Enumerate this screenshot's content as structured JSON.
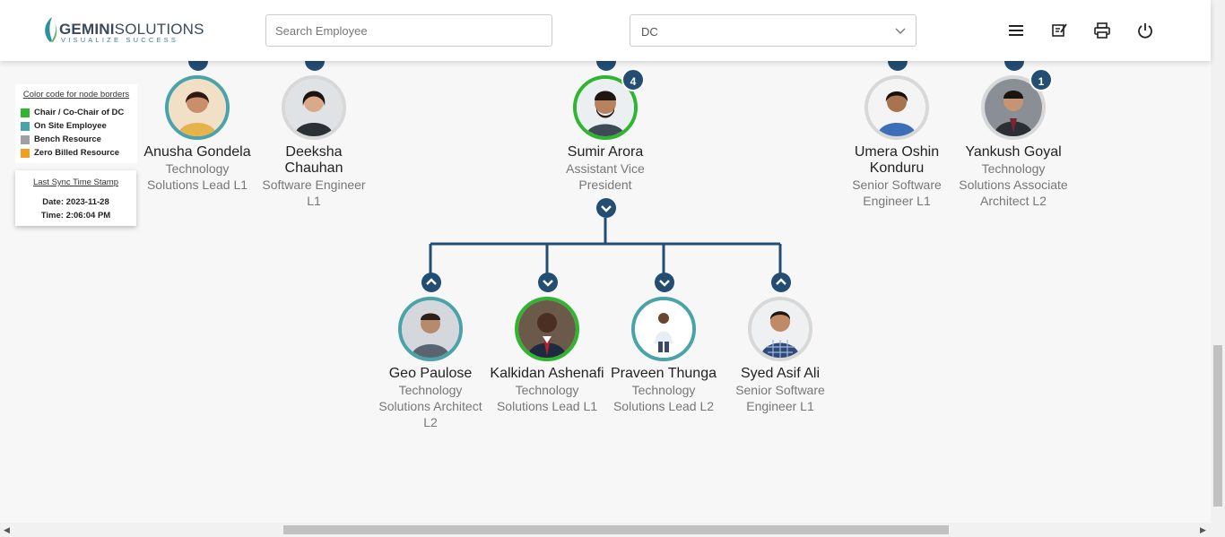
{
  "header": {
    "logo_name": "GEMINI",
    "logo_name_2": "SOLUTIONS",
    "logo_tagline": "VISUALIZE SUCCESS",
    "search_placeholder": "Search Employee",
    "dc_select_value": "DC"
  },
  "legend": {
    "title": "Color code for node borders",
    "items": [
      {
        "label": "Chair / Co-Chair of DC",
        "color": "#2fb52f"
      },
      {
        "label": "On Site Employee",
        "color": "#4aa3a8"
      },
      {
        "label": "Bench Resource",
        "color": "#a0a0a0"
      },
      {
        "label": "Zero Billed Resource",
        "color": "#f0a020"
      }
    ]
  },
  "sync": {
    "title": "Last Sync Time Stamp",
    "date": "Date: 2023-11-28",
    "time": "Time: 2:06:04 PM"
  },
  "nodes_top": [
    {
      "name": "Anusha Gondela",
      "title": "Technology Solutions Lead L1",
      "border": "#4aa3a8"
    },
    {
      "name": "Deeksha Chauhan",
      "title": "Software Engineer L1",
      "border": "#a0a0a0"
    },
    {
      "name": "Sumir Arora",
      "title": "Assistant Vice President",
      "border": "#2fb52f",
      "badge": "4"
    },
    {
      "name": "Umera Oshin Konduru",
      "title": "Senior Software Engineer L1",
      "border": "#a0a0a0"
    },
    {
      "name": "Yankush Goyal",
      "title": "Technology Solutions Associate Architect L2",
      "border": "#a0a0a0",
      "badge": "1"
    }
  ],
  "nodes_bottom": [
    {
      "name": "Geo Paulose",
      "title": "Technology Solutions Architect L2",
      "border": "#4aa3a8"
    },
    {
      "name": "Kalkidan Ashenafi",
      "title": "Technology Solutions Lead L1",
      "border": "#2fb52f"
    },
    {
      "name": "Praveen Thunga",
      "title": "Technology Solutions Lead L2",
      "border": "#4aa3a8"
    },
    {
      "name": "Syed Asif Ali",
      "title": "Senior Software Engineer L1",
      "border": "#a0a0a0"
    }
  ],
  "colors": {
    "connector": "#234d72"
  }
}
